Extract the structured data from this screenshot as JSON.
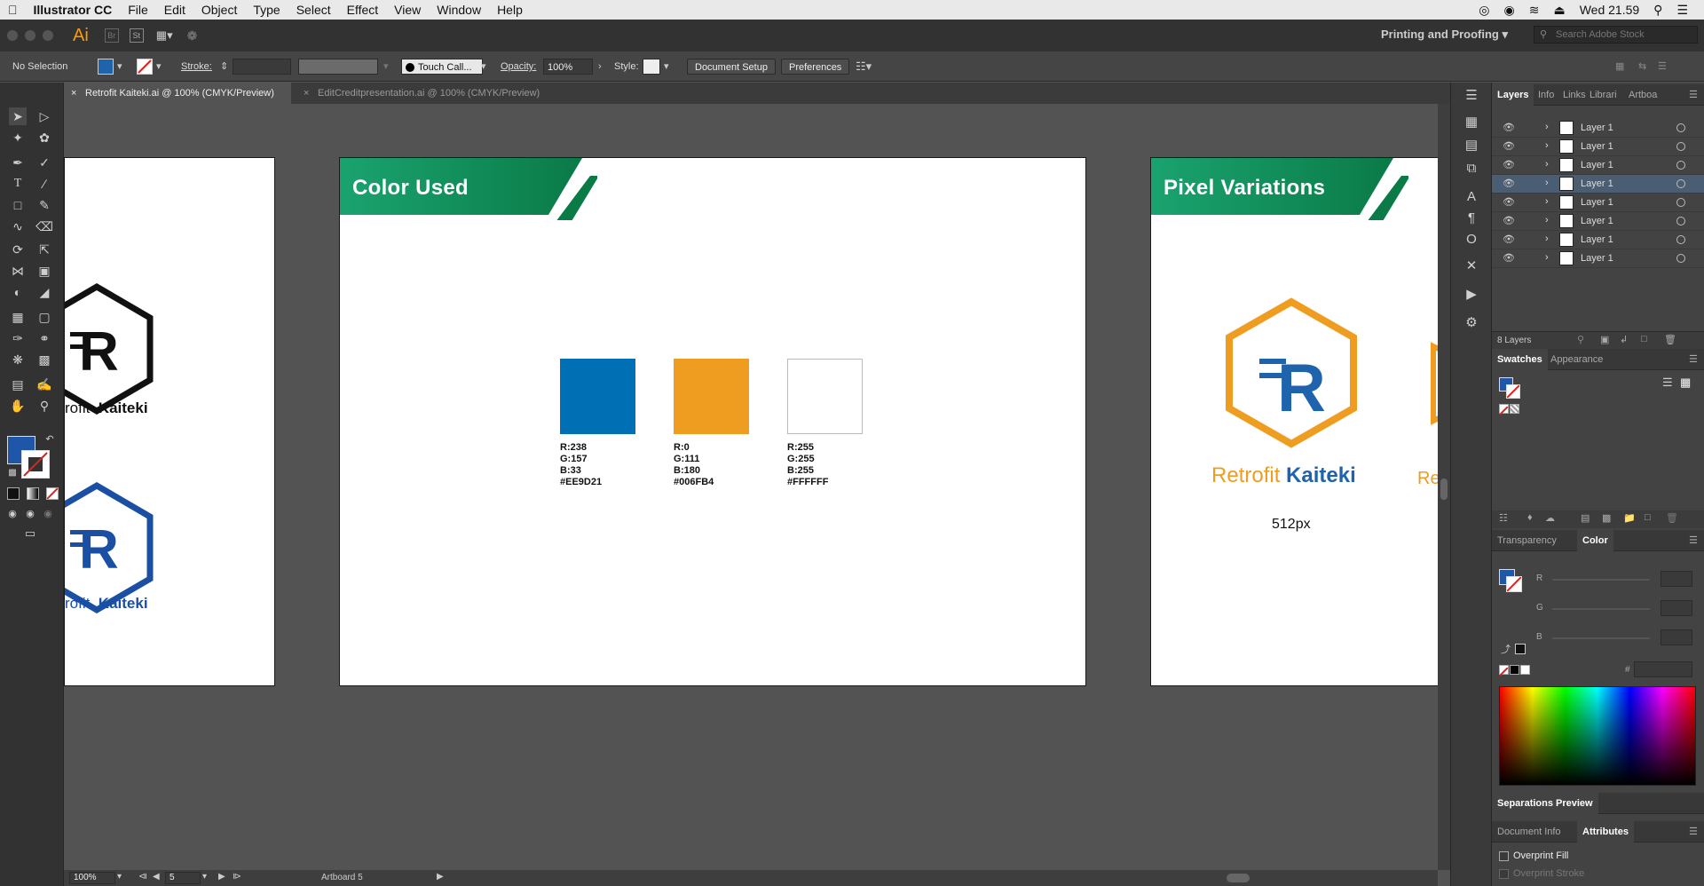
{
  "menubar": {
    "app": "Illustrator CC",
    "items": [
      "File",
      "Edit",
      "Object",
      "Type",
      "Select",
      "Effect",
      "View",
      "Window",
      "Help"
    ],
    "clock": "Wed 21.59"
  },
  "appbar": {
    "logo": "Ai",
    "br": "Br",
    "st": "St",
    "workspace": "Printing and Proofing",
    "stock_placeholder": "Search Adobe Stock"
  },
  "control": {
    "selection": "No Selection",
    "stroke_label": "Stroke:",
    "brush": "Touch Call...",
    "opacity_label": "Opacity:",
    "opacity_value": "100%",
    "style_label": "Style:",
    "doc_setup": "Document Setup",
    "preferences": "Preferences"
  },
  "tabs": [
    {
      "label": "Retrofit Kaiteki.ai @ 100% (CMYK/Preview)",
      "active": true
    },
    {
      "label": "EditCreditpresentation.ai @ 100% (CMYK/Preview)",
      "active": false
    }
  ],
  "artboard1": {
    "logo1_text_a": "rofit",
    "logo1_text_b": "Kaiteki",
    "logo2_text_a": "rofit",
    "logo2_text_b": "Kaiteki"
  },
  "artboard2": {
    "title": "Color Used",
    "swatches": [
      {
        "color": "#006FB4",
        "label": "R:238\nG:157\nB:33\n#EE9D21"
      },
      {
        "color": "#EE9D21",
        "label": "R:0\nG:111\nB:180\n#006FB4"
      },
      {
        "color": "#FFFFFF",
        "label": "R:255\nG:255\nB:255\n#FFFFFF"
      }
    ]
  },
  "artboard3": {
    "title": "Pixel Variations",
    "logo_text_a": "Retrofit",
    "logo_text_b": "Kaiteki",
    "size_label": "512px",
    "partial_text": "Re"
  },
  "status": {
    "zoom": "100%",
    "artboard_num": "5",
    "artboard_label": "Artboard 5"
  },
  "panels": {
    "layer_tabs": [
      "Layers",
      "Info",
      "Links",
      "Librari",
      "Artboa"
    ],
    "layers": [
      "Layer 1",
      "Layer 1",
      "Layer 1",
      "Layer 1",
      "Layer 1",
      "Layer 1",
      "Layer 1",
      "Layer 1"
    ],
    "layer_count": "8 Layers",
    "swatch_tabs": [
      "Swatches",
      "Appearance"
    ],
    "color_tabs": [
      "Transparency",
      "Color"
    ],
    "rgb_labels": [
      "R",
      "G",
      "B"
    ],
    "hash": "#",
    "sep_preview": "Separations Preview",
    "info_tabs": [
      "Document Info",
      "Attributes"
    ],
    "overprint_fill": "Overprint Fill",
    "overprint_stroke": "Overprint Stroke"
  },
  "colors": {
    "green": "#0f8a57",
    "blue": "#1f63ad",
    "orange": "#EE9D21"
  }
}
